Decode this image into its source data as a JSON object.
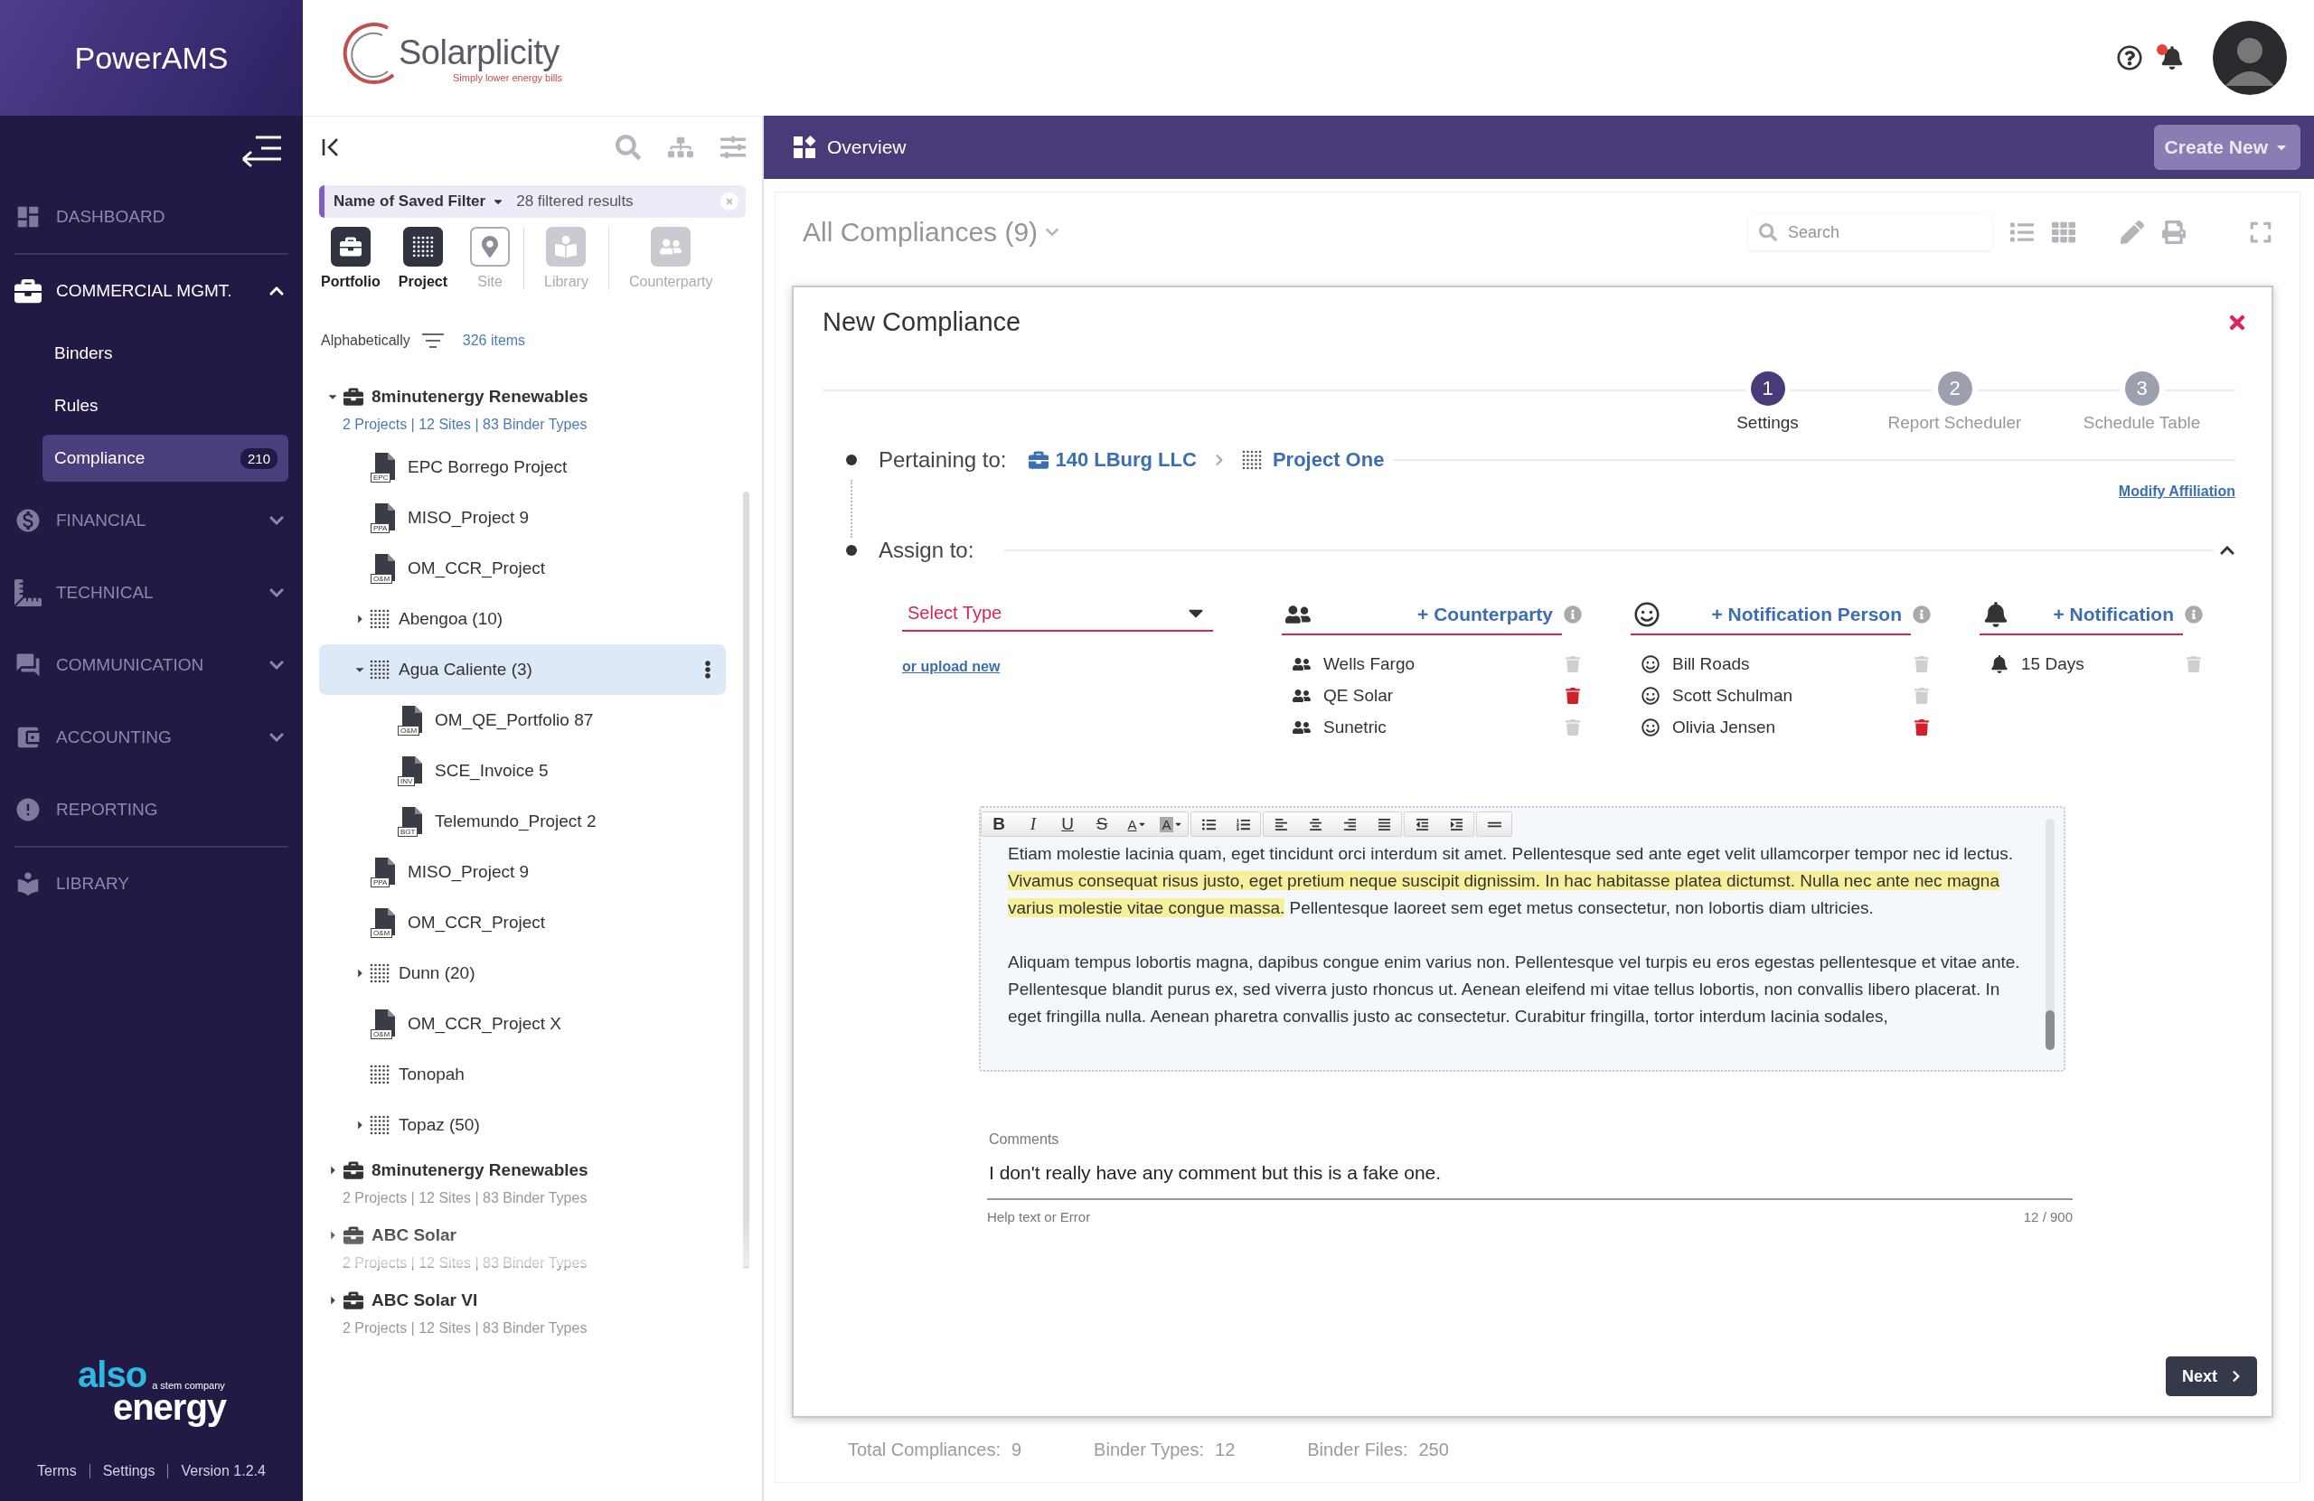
{
  "sidebar": {
    "title": "PowerAMS",
    "items": [
      {
        "label": "DASHBOARD",
        "divider_after": true
      },
      {
        "label": "COMMERCIAL MGMT.",
        "expanded": true,
        "children": [
          {
            "label": "Binders",
            "selected": false
          },
          {
            "label": "Rules",
            "selected": false
          },
          {
            "label": "Compliance",
            "selected": true,
            "badge": "210"
          }
        ]
      },
      {
        "label": "FINANCIAL",
        "expanded": false
      },
      {
        "label": "TECHNICAL",
        "expanded": false
      },
      {
        "label": "COMMUNICATION",
        "expanded": false
      },
      {
        "label": "ACCOUNTING",
        "expanded": false
      },
      {
        "label": "REPORTING",
        "divider_after": true
      },
      {
        "label": "LIBRARY"
      }
    ],
    "logo": {
      "word_1": "also",
      "word_2": "energy",
      "tagline": "a stem company"
    },
    "footer_links": [
      "Terms",
      "Settings",
      "Version 1.2.4"
    ]
  },
  "header": {
    "brand": {
      "name": "Solarplicity",
      "tagline": "Simply lower energy bills"
    },
    "notifications": {
      "unread": true
    }
  },
  "browser": {
    "filter": {
      "name": "Name of Saved Filter",
      "results": "28 filtered results"
    },
    "types": [
      {
        "label": "Portfolio",
        "selected": true,
        "disabled": false
      },
      {
        "label": "Project",
        "selected": true,
        "disabled": false
      },
      {
        "label": "Site",
        "selected": false,
        "disabled": false
      },
      {
        "label": "Library",
        "selected": false,
        "disabled": true
      },
      {
        "label": "Counterparty",
        "selected": false,
        "disabled": true
      }
    ],
    "sort": {
      "label": "Alphabetically",
      "count": "326 items"
    },
    "tree": [
      {
        "kind": "portfolio",
        "label": "8minutenergy Renewables",
        "meta": "2 Projects | 12 Sites | 83 Binder Types",
        "expanded": true,
        "selected": false,
        "children": [
          {
            "kind": "file",
            "label": "EPC Borrego Project",
            "tag": "EPC",
            "selected": false
          },
          {
            "kind": "file",
            "label": "MISO_Project 9",
            "tag": "PPA",
            "selected": false
          },
          {
            "kind": "file",
            "label": "OM_CCR_Project",
            "tag": "O&M",
            "selected": false
          },
          {
            "kind": "project",
            "label": "Abengoa (10)",
            "expanded": false,
            "selected": false
          },
          {
            "kind": "project",
            "label": "Agua Caliente (3)",
            "expanded": true,
            "selected": true,
            "children": [
              {
                "kind": "file",
                "label": "OM_QE_Portfolio 87",
                "tag": "O&M",
                "selected": false
              },
              {
                "kind": "file",
                "label": "SCE_Invoice 5",
                "tag": "INV",
                "selected": false
              },
              {
                "kind": "file",
                "label": "Telemundo_Project 2",
                "tag": "BGT",
                "selected": false
              }
            ]
          },
          {
            "kind": "file",
            "label": "MISO_Project 9",
            "tag": "PPA",
            "selected": false
          },
          {
            "kind": "file",
            "label": "OM_CCR_Project",
            "tag": "O&M",
            "selected": false
          },
          {
            "kind": "project",
            "label": "Dunn (20)",
            "expanded": false,
            "selected": false
          },
          {
            "kind": "file",
            "label": "OM_CCR_Project X",
            "tag": "O&M",
            "selected": false
          },
          {
            "kind": "project",
            "label": "Tonopah",
            "selected": false
          },
          {
            "kind": "project",
            "label": "Topaz (50)",
            "expanded": false,
            "selected": false
          }
        ]
      },
      {
        "kind": "portfolio",
        "label": "8minutenergy Renewables",
        "meta": "2 Projects | 12 Sites | 83 Binder Types",
        "expanded": false,
        "selected": false
      },
      {
        "kind": "portfolio",
        "label": "ABC Solar",
        "meta": "2 Projects | 12 Sites | 83 Binder Types",
        "expanded": false,
        "selected": false
      },
      {
        "kind": "portfolio",
        "label": "ABC Solar VI",
        "meta": "2 Projects | 12 Sites | 83 Binder Types",
        "expanded": false,
        "selected": false
      }
    ]
  },
  "main": {
    "title": "Overview",
    "create_button": "Create New",
    "list_title": "All Compliances (9)",
    "search_placeholder": "Search",
    "stats": [
      {
        "label": "Total Compliances:",
        "value": "9"
      },
      {
        "label": "Binder Types:",
        "value": "12"
      },
      {
        "label": "Binder Files:",
        "value": "250"
      }
    ]
  },
  "modal": {
    "title": "New Compliance",
    "steps": [
      {
        "number": "1",
        "label": "Settings",
        "selected": true
      },
      {
        "number": "2",
        "label": "Report Scheduler",
        "selected": false
      },
      {
        "number": "3",
        "label": "Schedule Table",
        "selected": false
      }
    ],
    "pertaining": {
      "label": "Pertaining to:",
      "portfolio": "140 LBurg LLC",
      "project": "Project One",
      "modify_link": "Modify Affiliation"
    },
    "assign": {
      "label": "Assign to:",
      "expanded": true,
      "select_type": {
        "placeholder": "Select Type",
        "error": true
      },
      "upload_link": "or upload new",
      "groups": [
        {
          "kind": "counterparty",
          "add_label": "+ Counterparty",
          "entries": [
            {
              "name": "Wells Fargo",
              "delete_highlighted": false
            },
            {
              "name": "QE Solar",
              "delete_highlighted": true
            },
            {
              "name": "Sunetric",
              "delete_highlighted": false
            }
          ]
        },
        {
          "kind": "person",
          "add_label": "+ Notification Person",
          "entries": [
            {
              "name": "Bill Roads",
              "delete_highlighted": false
            },
            {
              "name": "Scott Schulman",
              "delete_highlighted": false
            },
            {
              "name": "Olivia Jensen",
              "delete_highlighted": true
            }
          ]
        },
        {
          "kind": "notification",
          "add_label": "+ Notification",
          "entries": [
            {
              "name": "15 Days",
              "delete_highlighted": false
            }
          ]
        }
      ]
    },
    "editor": {
      "format_buttons": [
        "B",
        "I",
        "U",
        "S"
      ],
      "color_buttons": [
        "A",
        "A"
      ],
      "paragraphs": [
        [
          {
            "text": " Etiam molestie lacinia quam, eget tincidunt orci interdum sit amet. Pellentesque sed ante eget velit ullamcorper tempor nec id lectus. ",
            "highlighted": false
          },
          {
            "text": "Vivamus consequat risus justo, eget pretium neque suscipit dignissim. In hac habitasse platea dictumst. Nulla nec ante nec magna varius molestie vitae congue massa.",
            "highlighted": true
          },
          {
            "text": " Pellentesque laoreet sem eget metus consectetur, non lobortis diam ultricies.",
            "highlighted": false
          }
        ],
        [
          {
            "text": "Aliquam tempus lobortis magna, dapibus congue enim varius non. Pellentesque vel turpis eu eros egestas pellentesque et vitae ante. Pellentesque blandit purus ex, sed viverra justo rhoncus ut. Aenean eleifend mi vitae tellus lobortis, non convallis libero placerat. In eget fringilla nulla. Aenean pharetra convallis justo ac consectetur. Curabitur fringilla, tortor interdum lacinia sodales,",
            "highlighted": false
          }
        ]
      ]
    },
    "comments": {
      "label": "Comments",
      "value": "I don't really have any comment but this is a fake one.",
      "help": "Help text or Error",
      "counter": "12 / 900"
    },
    "next_button": "Next"
  }
}
